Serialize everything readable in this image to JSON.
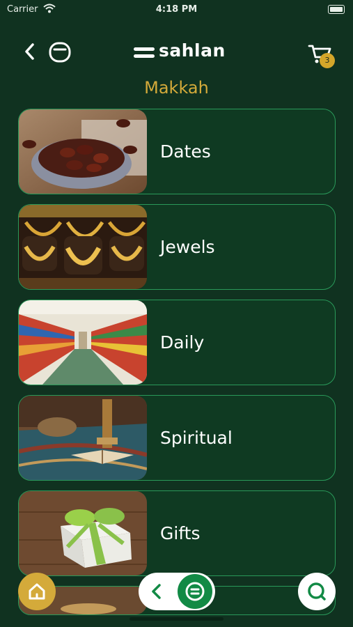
{
  "status_bar": {
    "carrier": "Carrier",
    "time": "4:18 PM"
  },
  "header": {
    "brand": "sahlan",
    "cart_count": "3",
    "icons": [
      "chevron-left-icon",
      "account-icon",
      "cart-icon"
    ]
  },
  "city": "Makkah",
  "categories": [
    {
      "label": "Dates",
      "image": "dates-bowl-image"
    },
    {
      "label": "Jewels",
      "image": "gold-jewelry-image"
    },
    {
      "label": "Daily",
      "image": "supermarket-aisle-image"
    },
    {
      "label": "Spiritual",
      "image": "prayer-beads-quran-image"
    },
    {
      "label": "Gifts",
      "image": "gift-box-image"
    }
  ],
  "bottom_nav": {
    "icons": [
      "home-icon",
      "chevron-left-icon",
      "menu-icon",
      "search-icon"
    ]
  },
  "colors": {
    "background": "#103220",
    "card_border": "#2a9a5a",
    "accent_gold": "#d4aa3a",
    "accent_green": "#128a45"
  }
}
